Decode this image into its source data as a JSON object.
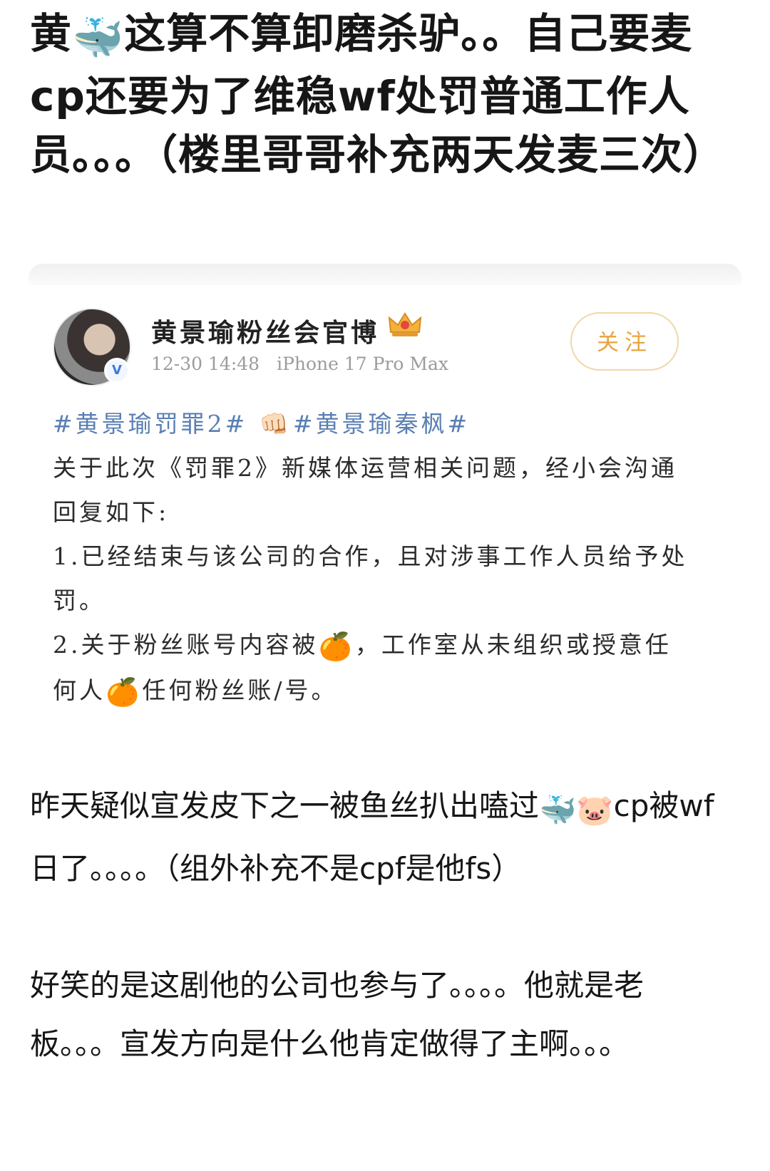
{
  "post": {
    "title_part1": "黄",
    "title_emoji1": "🐳",
    "title_part2": "这算不算卸磨杀驴。。自己要麦cp还要为了维稳wf处罚普通工作人员。。。（楼里哥哥补充两天发麦三次）",
    "paragraph1_part1": "昨天疑似宣发皮下之一被鱼丝扒出嗑过",
    "paragraph1_emoji1": "🐳",
    "paragraph1_emoji2": "🐷",
    "paragraph1_part2": "cp被wf日了。。。。（组外补充不是cpf是他fs）",
    "paragraph2": "好笑的是这剧他的公司也参与了。。。。他就是老板。。。宣发方向是什么他肯定做得了主啊。。。"
  },
  "card": {
    "account_name": "黄景瑜粉丝会官博",
    "verified_mark": "V",
    "crown_icon": "crown-badge-icon",
    "timestamp": "12-30 14:48",
    "device": "iPhone 17 Pro Max",
    "follow_label": "关注",
    "hashtag1": "#黄景瑜罚罪2#",
    "fist_emoji": "👊🏻",
    "hashtag2": "#黄景瑜秦枫#",
    "line1": "关于此次《罚罪2》新媒体运营相关问题，经小会沟通回复如下:",
    "line2": "1.已经结束与该公司的合作，且对涉事工作人员给予处罚。",
    "line3_part1": "2.关于粉丝账号内容被",
    "orange_emoji": "🍊",
    "line3_part2": "，工作室从未组织或授意任何人",
    "line3_part3": "任何粉丝账/号。",
    "accent_color": "#e9a43f",
    "hashtag_color": "#5a7fb3"
  }
}
